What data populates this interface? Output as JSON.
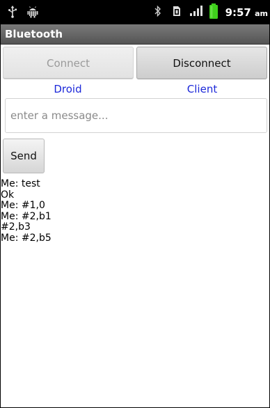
{
  "status_bar": {
    "time": "9:57",
    "ampm": "am",
    "icons": [
      "usb-icon",
      "android-debug-icon",
      "bluetooth-icon",
      "sim-icon",
      "signal-icon",
      "battery-icon"
    ]
  },
  "title_bar": {
    "title": "Bluetooth"
  },
  "buttons": {
    "connect_label": "Connect",
    "disconnect_label": "Disconnect"
  },
  "labels": {
    "device_label": "Droid",
    "role_label": "Client"
  },
  "message_input": {
    "placeholder": "enter a message...",
    "value": ""
  },
  "send_button": {
    "label": "Send"
  },
  "messages": [
    "Me: test",
    "Ok",
    "Me: #1,0",
    "Me: #2,b1",
    "#2,b3",
    "Me: #2,b5"
  ],
  "colors": {
    "status_bar_bg": "#000000",
    "title_bar_bg": "#5e5e5e",
    "label_text": "#1c28d9",
    "battery": "#3fcf1c"
  }
}
